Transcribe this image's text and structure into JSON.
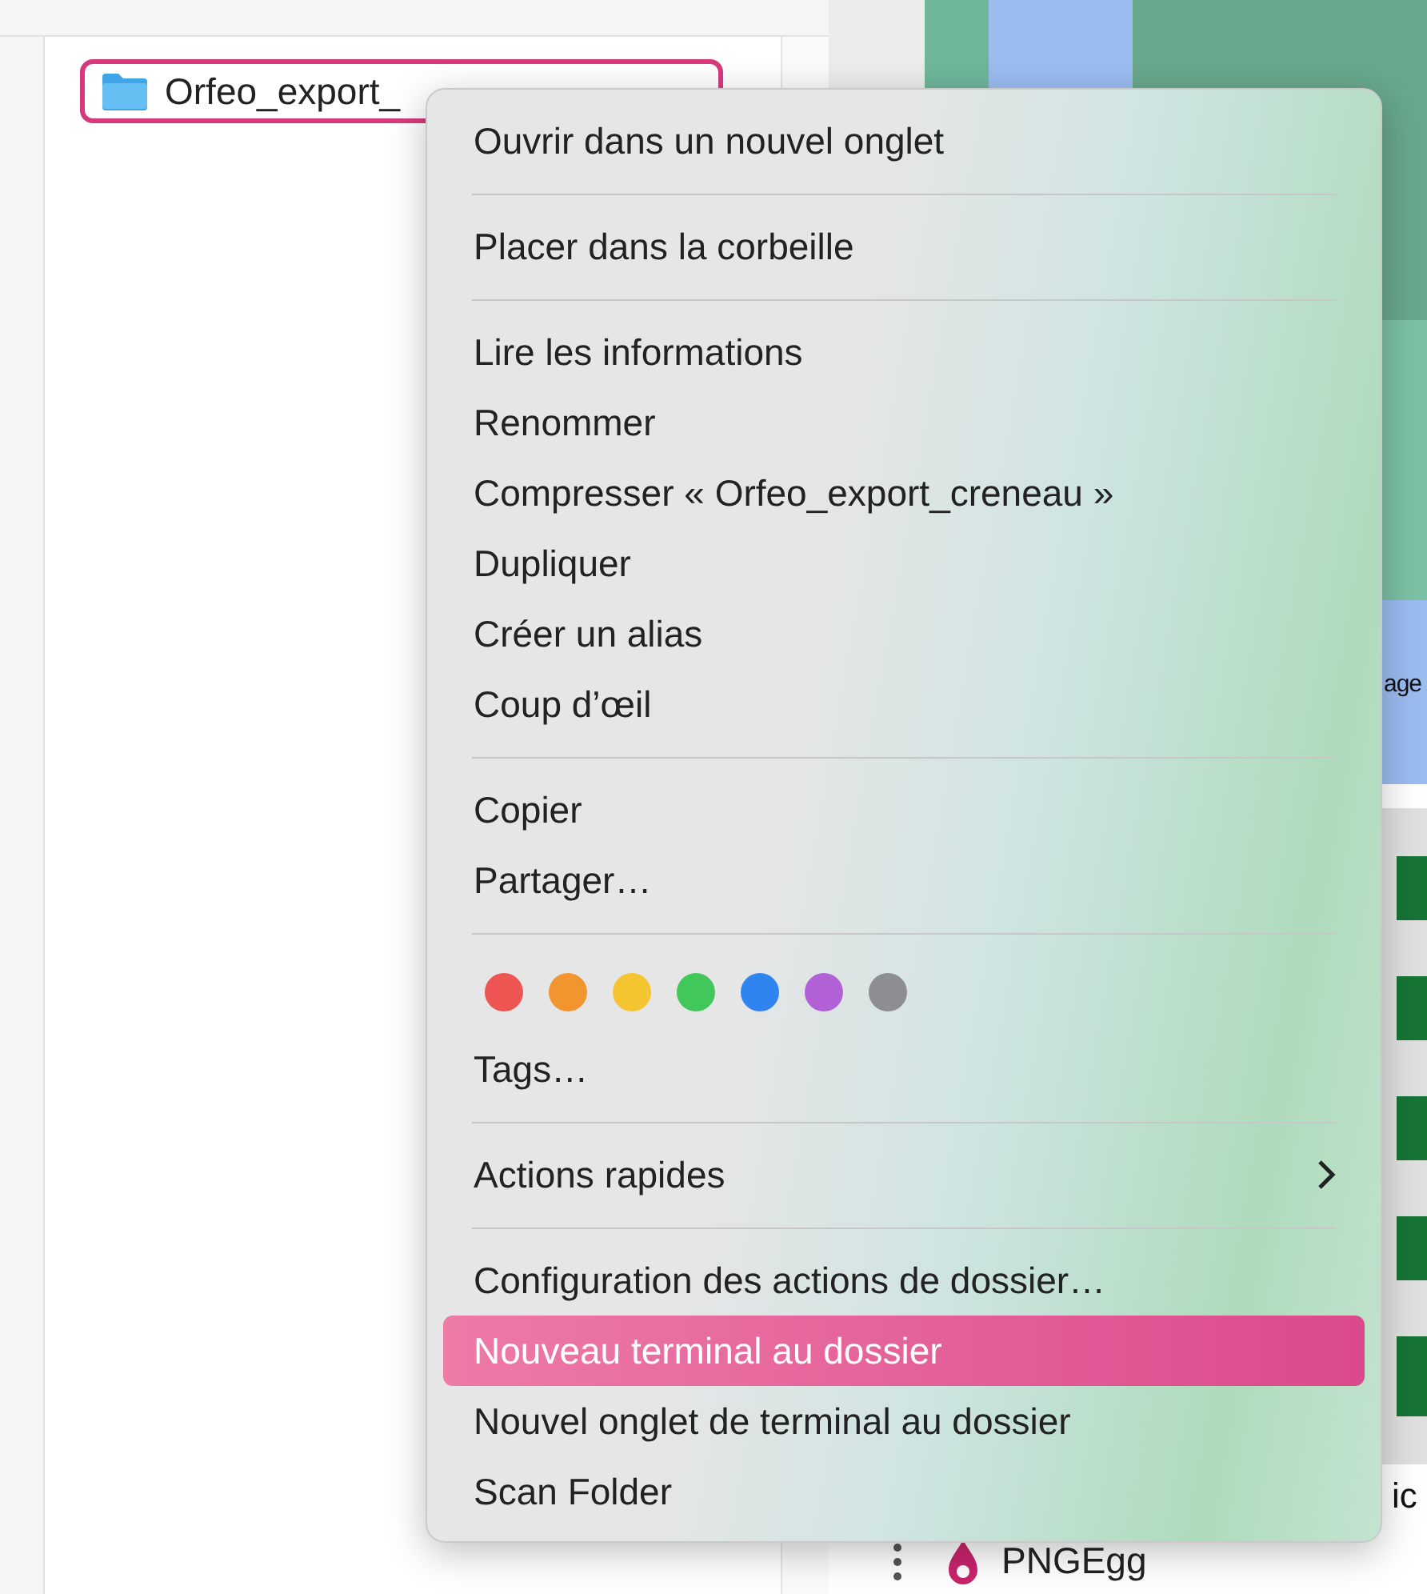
{
  "finder": {
    "item": {
      "name": "Orfeo_export_",
      "selected": true
    }
  },
  "background_page": {
    "side_label": "age",
    "caption": "ic",
    "list_item": "PNGEgg"
  },
  "context_menu": {
    "sections": [
      {
        "items": [
          {
            "kind": "item",
            "label": "Ouvrir dans un nouvel onglet",
            "selected": false
          }
        ]
      },
      {
        "items": [
          {
            "kind": "item",
            "label": "Placer dans la corbeille",
            "selected": false
          }
        ]
      },
      {
        "items": [
          {
            "kind": "item",
            "label": "Lire les informations",
            "selected": false
          },
          {
            "kind": "item",
            "label": "Renommer",
            "selected": false
          },
          {
            "kind": "item",
            "label": "Compresser « Orfeo_export_creneau »",
            "selected": false
          },
          {
            "kind": "item",
            "label": "Dupliquer",
            "selected": false
          },
          {
            "kind": "item",
            "label": "Créer un alias",
            "selected": false
          },
          {
            "kind": "item",
            "label": "Coup d’œil",
            "selected": false
          }
        ]
      },
      {
        "items": [
          {
            "kind": "item",
            "label": "Copier",
            "selected": false
          },
          {
            "kind": "item",
            "label": "Partager…",
            "selected": false
          }
        ]
      },
      {
        "items": [
          {
            "kind": "colors",
            "tags": [
              {
                "color": "#ee5451"
              },
              {
                "color": "#f2952f"
              },
              {
                "color": "#f5c431"
              },
              {
                "color": "#41c75a"
              },
              {
                "color": "#2f84f0"
              },
              {
                "color": "#b160d6"
              },
              {
                "color": "#8e8e92"
              }
            ]
          },
          {
            "kind": "item",
            "label": "Tags…",
            "selected": false
          }
        ]
      },
      {
        "items": [
          {
            "kind": "submenu",
            "label": "Actions rapides",
            "selected": false
          }
        ]
      },
      {
        "items": [
          {
            "kind": "item",
            "label": "Configuration des actions de dossier…",
            "selected": false
          },
          {
            "kind": "item",
            "label": "Nouveau terminal au dossier",
            "selected": true
          },
          {
            "kind": "item",
            "label": "Nouvel onglet de terminal au dossier",
            "selected": false
          },
          {
            "kind": "item",
            "label": "Scan Folder",
            "selected": false
          }
        ]
      }
    ]
  }
}
